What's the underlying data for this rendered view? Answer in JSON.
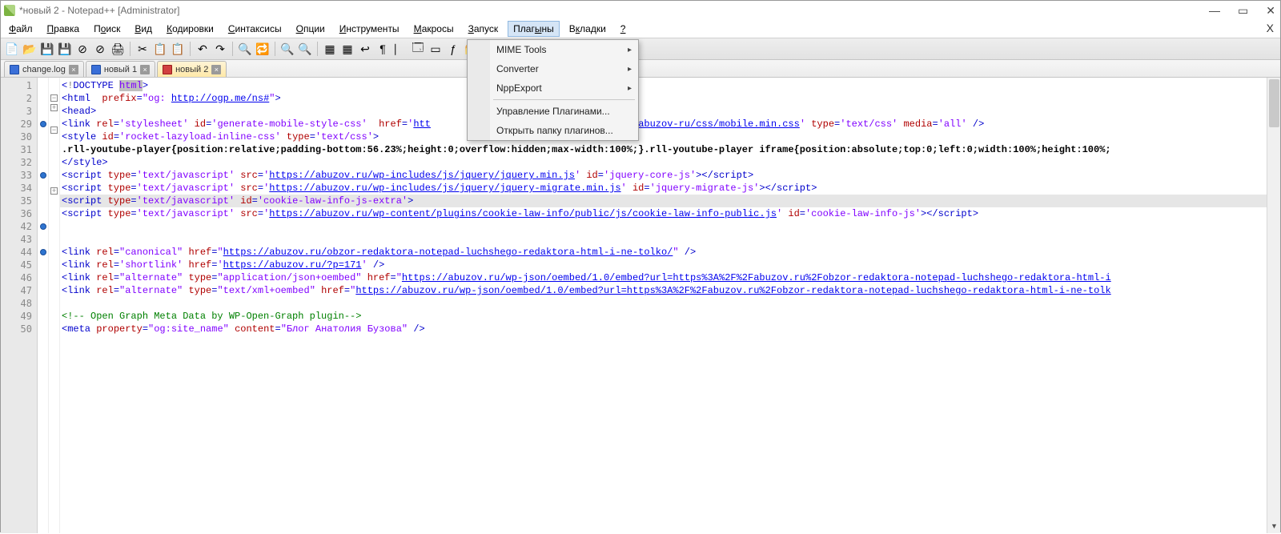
{
  "title_bar": {
    "text": "*новый 2 - Notepad++ [Administrator]"
  },
  "win_controls": {
    "minimize": "—",
    "maximize": "▭",
    "close": "✕"
  },
  "menu": {
    "items": [
      {
        "label": "Файл",
        "u": "Ф"
      },
      {
        "label": "Правка",
        "u": "П"
      },
      {
        "label": "Поиск",
        "u": "о"
      },
      {
        "label": "Вид",
        "u": "В"
      },
      {
        "label": "Кодировки",
        "u": "К"
      },
      {
        "label": "Синтаксисы",
        "u": "С"
      },
      {
        "label": "Опции",
        "u": "О"
      },
      {
        "label": "Инструменты",
        "u": "И"
      },
      {
        "label": "Макросы",
        "u": "М"
      },
      {
        "label": "Запуск",
        "u": "З"
      },
      {
        "label": "Плагины",
        "u": "ы",
        "active": true
      },
      {
        "label": "Вкладки",
        "u": "к"
      },
      {
        "label": "?",
        "u": "?"
      }
    ],
    "help_close": "X"
  },
  "dropdown": {
    "items": [
      {
        "label": "MIME Tools",
        "sub": true
      },
      {
        "label": "Converter",
        "sub": true
      },
      {
        "label": "NppExport",
        "sub": true
      }
    ],
    "sep": true,
    "manage": "Управление Плагинами...",
    "open_folder": "Открыть папку плагинов..."
  },
  "tabs": [
    {
      "label": "change.log",
      "icon": "blue"
    },
    {
      "label": "новый 1",
      "icon": "blue"
    },
    {
      "label": "новый 2",
      "icon": "red",
      "active": true
    }
  ],
  "line_numbers": [
    "1",
    "2",
    "3",
    "29",
    "30",
    "31",
    "32",
    "33",
    "34",
    "35",
    "36",
    "42",
    "43",
    "44",
    "45",
    "46",
    "47",
    "48",
    "49",
    "50"
  ],
  "markers": [
    false,
    false,
    false,
    true,
    false,
    false,
    false,
    true,
    false,
    false,
    false,
    true,
    false,
    true,
    false,
    false,
    false,
    false,
    false,
    false
  ],
  "folds": [
    "",
    "⊟",
    "⊞",
    "",
    "⊟",
    "",
    "",
    "",
    "",
    "⊞",
    "",
    "",
    "",
    "",
    "",
    "",
    "",
    "",
    "",
    ""
  ],
  "code_lines": {
    "l1": {
      "type": "doctype",
      "text": "<!DOCTYPE html>"
    },
    "l2": {
      "type": "html-open",
      "prefix": "prefix=",
      "val": "\"og: ",
      "url": "http://ogp.me/ns#",
      "val2": "\""
    },
    "l3": {
      "type": "head-open",
      "text": "<head>"
    },
    "l29": {
      "type": "link",
      "rel": "'stylesheet'",
      "id": "'generate-mobile-style-css'",
      "href_start": "'htt",
      "href_url": "hemes/abuzov-ru/css/mobile.min.css'",
      "tpe": "'text/css'",
      "media": "'all'"
    },
    "l30": {
      "type": "style-open",
      "id": "'rocket-lazyload-inline-css'",
      "tpe": "'text/css'"
    },
    "l31": {
      "type": "css-text",
      "text": ".rll-youtube-player{position:relative;padding-bottom:56.23%;height:0;overflow:hidden;max-width:100%;}.rll-youtube-player iframe{position:absolute;top:0;left:0;width:100%;height:100%;"
    },
    "l32": {
      "type": "style-close",
      "text": "</style>"
    },
    "l33": {
      "type": "script-src",
      "tpe": "'text/javascript'",
      "src": "'",
      "url": "https://abuzov.ru/wp-includes/js/jquery/jquery.min.js",
      "src_end": "'",
      "id": "'jquery-core-js'"
    },
    "l34": {
      "type": "script-src",
      "tpe": "'text/javascript'",
      "src": "'",
      "url": "https://abuzov.ru/wp-includes/js/jquery/jquery-migrate.min.js",
      "src_end": "'",
      "id": "'jquery-migrate-js'"
    },
    "l35": {
      "type": "script-open",
      "tpe": "'text/javascript'",
      "id": "'cookie-law-info-js-extra'"
    },
    "l36": {
      "type": "script-src",
      "tpe": "'text/javascript'",
      "src": "'",
      "url": "https://abuzov.ru/wp-content/plugins/cookie-law-info/public/js/cookie-law-info-public.js",
      "src_end": "'",
      "id": "'cookie-law-info-js'"
    },
    "l42": {
      "type": "empty"
    },
    "l43": {
      "type": "empty"
    },
    "l44": {
      "type": "link-dq",
      "rel": "\"canonical\"",
      "url": "https://abuzov.ru/obzor-redaktora-notepad-luchshego-redaktora-html-i-ne-tolko/"
    },
    "l45": {
      "type": "link-short",
      "rel": "'shortlink'",
      "url": "https://abuzov.ru/?p=171"
    },
    "l46": {
      "type": "link-alt",
      "rel": "\"alternate\"",
      "tpe": "\"application/json+oembed\"",
      "url": "https://abuzov.ru/wp-json/oembed/1.0/embed?url=https%3A%2F%2Fabuzov.ru%2Fobzor-redaktora-notepad-luchshego-redaktora-html-i"
    },
    "l47": {
      "type": "link-alt",
      "rel": "\"alternate\"",
      "tpe": "\"text/xml+oembed\"",
      "url": "https://abuzov.ru/wp-json/oembed/1.0/embed?url=https%3A%2F%2Fabuzov.ru%2Fobzor-redaktora-notepad-luchshego-redaktora-html-i-ne-tolk"
    },
    "l48": {
      "type": "empty"
    },
    "l49": {
      "type": "comment",
      "text": "<!-- Open Graph Meta Data by WP-Open-Graph plugin-->"
    },
    "l50": {
      "type": "meta",
      "prop": "\"og:site_name\"",
      "content": "\"Блог Анатолия Бузова\""
    }
  }
}
